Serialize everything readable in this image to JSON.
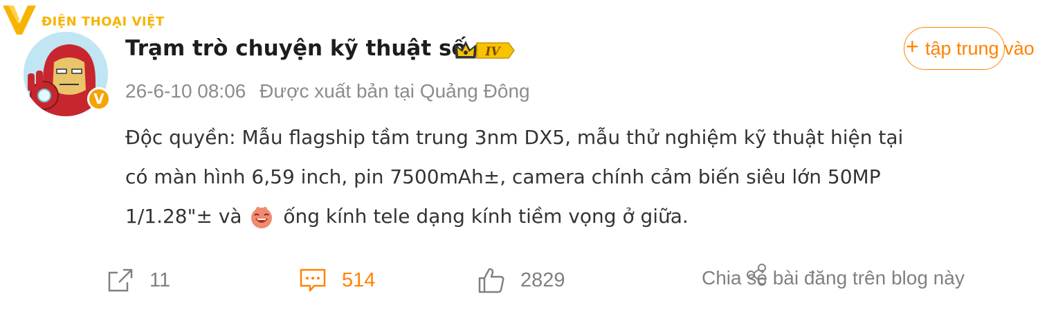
{
  "watermark": {
    "text": "ĐIỆN THOẠI VIỆT"
  },
  "author": {
    "name": "Trạm trò chuyện kỹ thuật số",
    "rank": "IV",
    "verified_mark": "V"
  },
  "meta": {
    "date": "26-6-10 08:06",
    "location": "Được xuất bản tại Quảng Đông"
  },
  "follow_button": {
    "plus": "+",
    "label": "tập trung vào"
  },
  "post": {
    "line1": "Độc quyền: Mẫu flagship tầm trung 3nm DX5, mẫu thử nghiệm kỹ thuật hiện tại",
    "line2": "có màn hình 6,59 inch, pin 7500mAh±, camera chính cảm biến siêu lớn 50MP",
    "line3_before": "1/1.28\"± và",
    "line3_after": "ống kính tele dạng kính tiềm vọng ở giữa."
  },
  "actions": {
    "repost_count": "11",
    "comment_count": "514",
    "like_count": "2829",
    "share_blog_label": "Chia sẻ bài đăng trên blog này"
  },
  "colors": {
    "accent": "#ff8200",
    "gold": "#f6b400",
    "muted": "#8c8c8c"
  },
  "icons": [
    "logo-v-icon",
    "crown-icon",
    "repost-icon",
    "comment-icon",
    "like-icon",
    "share-icon",
    "laughing-emoji-icon"
  ]
}
